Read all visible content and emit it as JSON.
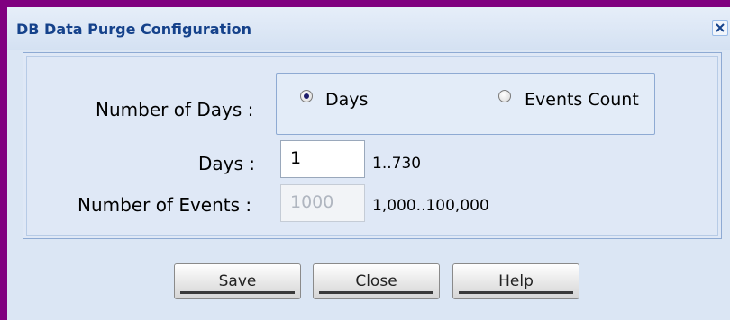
{
  "dialog": {
    "title": "DB Data Purge Configuration",
    "close_icon": "close-icon"
  },
  "form": {
    "number_of_days_label": "Number of Days :",
    "options": [
      {
        "label": "Days",
        "selected": true
      },
      {
        "label": "Events Count",
        "selected": false
      }
    ],
    "days_label": "Days :",
    "days_value": "1",
    "days_range": "1..730",
    "events_label": "Number of Events :",
    "events_value": "1000",
    "events_range": "1,000..100,000"
  },
  "buttons": {
    "save": "Save",
    "close": "Close",
    "help": "Help"
  },
  "colors": {
    "background": "#800080",
    "title": "#15428b",
    "panel": "#dfe8f6"
  }
}
